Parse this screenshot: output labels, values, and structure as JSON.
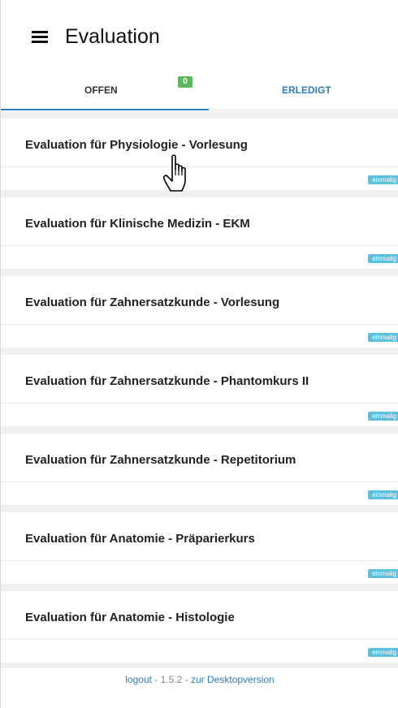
{
  "header": {
    "title": "Evaluation",
    "menu_icon": "hamburger-menu-icon"
  },
  "tabs": {
    "open": {
      "label": "OFFEN",
      "badge": "0"
    },
    "done": {
      "label": "ERLEDIGT"
    },
    "colors": {
      "active_underline": "#2f7dc0",
      "badge": "#5cb85c",
      "link": "#2f7dc0"
    }
  },
  "items": [
    {
      "title": "Evaluation für Physiologie - Vorlesung",
      "tag": "einmalig"
    },
    {
      "title": "Evaluation für Klinische Medizin - EKM",
      "tag": "einmalig"
    },
    {
      "title": "Evaluation für Zahnersatzkunde - Vorlesung",
      "tag": "einmalig"
    },
    {
      "title": "Evaluation für Zahnersatzkunde - Phantomkurs II",
      "tag": "einmalig"
    },
    {
      "title": "Evaluation für Zahnersatzkunde - Repetitorium",
      "tag": "einmalig"
    },
    {
      "title": "Evaluation für Anatomie - Präparierkurs",
      "tag": "einmalig"
    },
    {
      "title": "Evaluation für Anatomie - Histologie",
      "tag": "einmalig"
    }
  ],
  "footer": {
    "logout": "logout",
    "separator1": " - ",
    "version": "1.5.2",
    "separator2": " - ",
    "desktop": "zur Desktopversion"
  },
  "tag_color": "#5bc0de",
  "cursor_icon": "pointer-hand-icon"
}
